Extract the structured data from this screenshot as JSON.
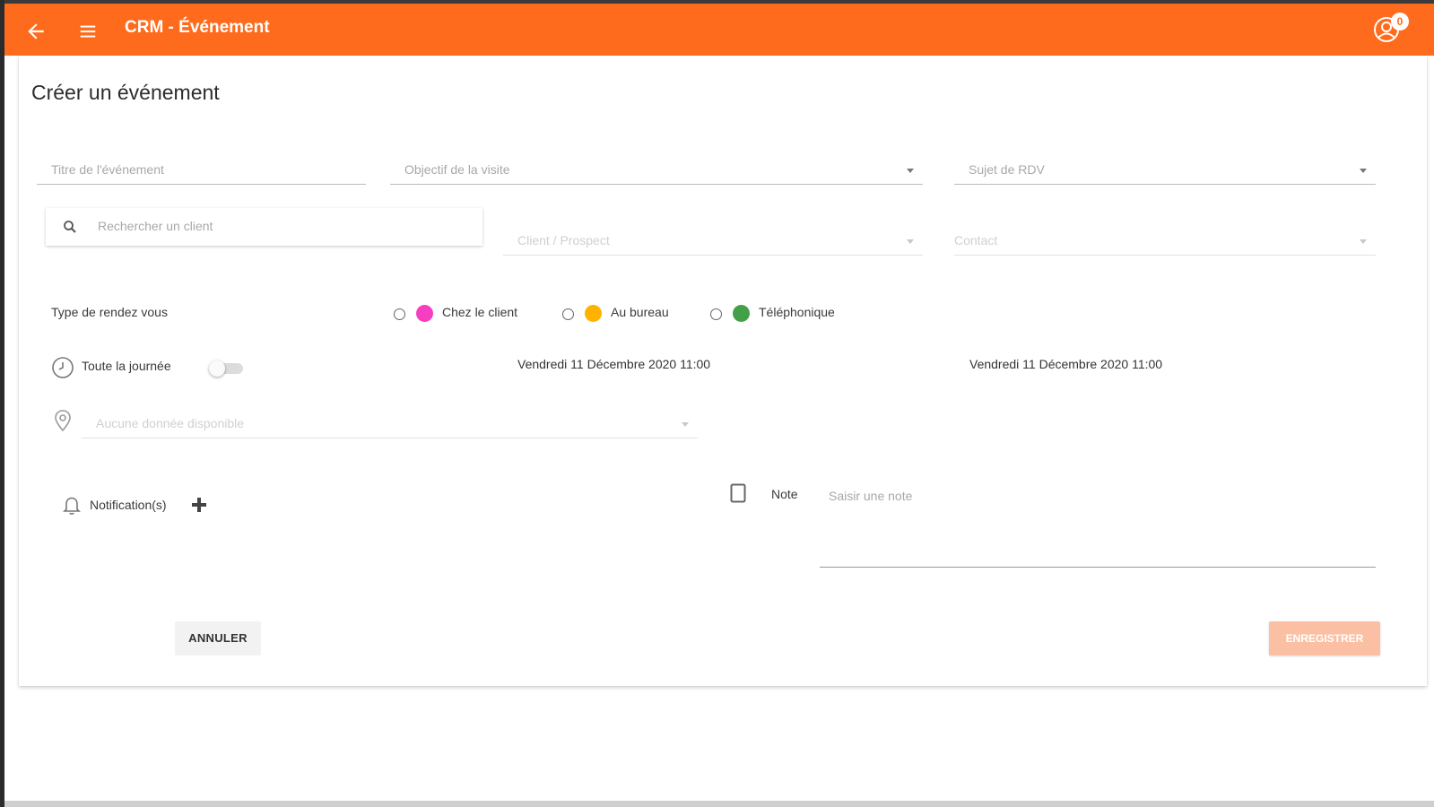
{
  "header": {
    "title": "CRM - Événement",
    "notification_count": "0",
    "back_icon": "arrow-left-icon",
    "menu_icon": "hamburger-menu-icon",
    "user_icon": "user-circle-icon"
  },
  "form": {
    "heading": "Créer un événement",
    "title_placeholder": "Titre de l'événement",
    "objective_placeholder": "Objectif de la visite",
    "subject_placeholder": "Sujet de RDV",
    "search_placeholder": "Rechercher un client",
    "client_placeholder": "Client / Prospect",
    "contact_placeholder": "Contact",
    "appointment_type_label": "Type de rendez vous",
    "appointment_types": [
      {
        "label": "Chez le client",
        "color": "#F53FC0"
      },
      {
        "label": "Au bureau",
        "color": "#FFB300"
      },
      {
        "label": "Téléphonique",
        "color": "#43A047"
      }
    ],
    "all_day_label": "Toute la journée",
    "all_day_enabled": false,
    "start_date": "Vendredi 11 Décembre 2020 11:00",
    "end_date": "Vendredi 11 Décembre 2020 11:00",
    "location_placeholder": "Aucune donnée disponible",
    "notifications_label": "Notification(s)",
    "note_label": "Note",
    "note_placeholder": "Saisir une note",
    "cancel_label": "ANNULER",
    "save_label": "ENREGISTRER"
  },
  "colors": {
    "brand": "#FF6B1C",
    "save_disabled": "#FBC0A4"
  }
}
